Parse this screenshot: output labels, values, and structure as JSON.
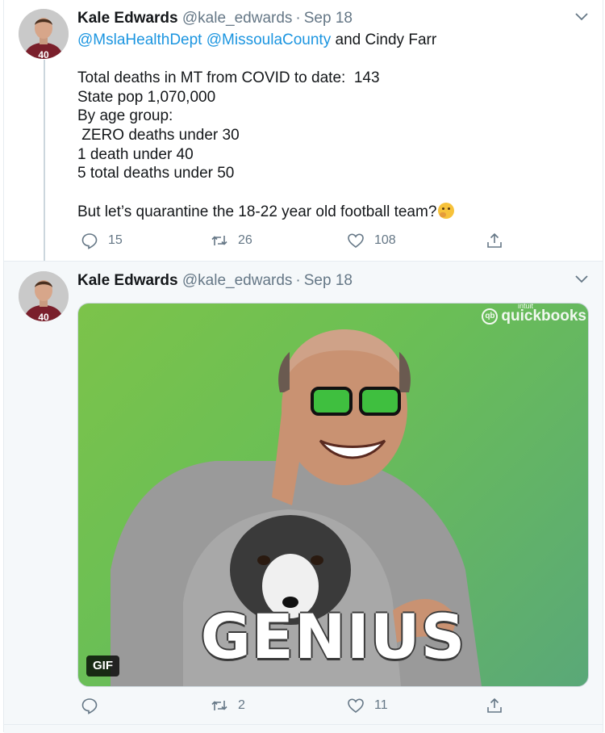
{
  "tweets": [
    {
      "name": "Kale Edwards",
      "handle": "@kale_edwards",
      "separator": "·",
      "date": "Sep 18",
      "reply_mentions": [
        "@MslaHealthDept",
        "@MissoulaCounty"
      ],
      "reply_suffix": "and Cindy Farr",
      "body_lines": [
        "Total deaths in MT from COVID to date:  143",
        "State pop 1,070,000",
        "By age group:",
        " ZERO deaths under 30",
        "1 death under 40",
        "5 total deaths under 50",
        "",
        "But let’s quarantine the 18-22 year old football team?"
      ],
      "body_emoji": "thinking-face-emoji",
      "actions": {
        "replies": "15",
        "retweets": "26",
        "likes": "108"
      }
    },
    {
      "name": "Kale Edwards",
      "handle": "@kale_edwards",
      "separator": "·",
      "date": "Sep 18",
      "media": {
        "type": "GIF",
        "badge": "GIF",
        "overlay_text": "GENIUS",
        "watermark_small": "intuit",
        "watermark": "quickbooks",
        "background_color": "#6bbf55"
      },
      "actions": {
        "replies": "",
        "retweets": "2",
        "likes": "11"
      }
    }
  ],
  "colors": {
    "link": "#1b95e0",
    "secondary_text": "#657786",
    "thread_line": "#ccd6dd"
  }
}
